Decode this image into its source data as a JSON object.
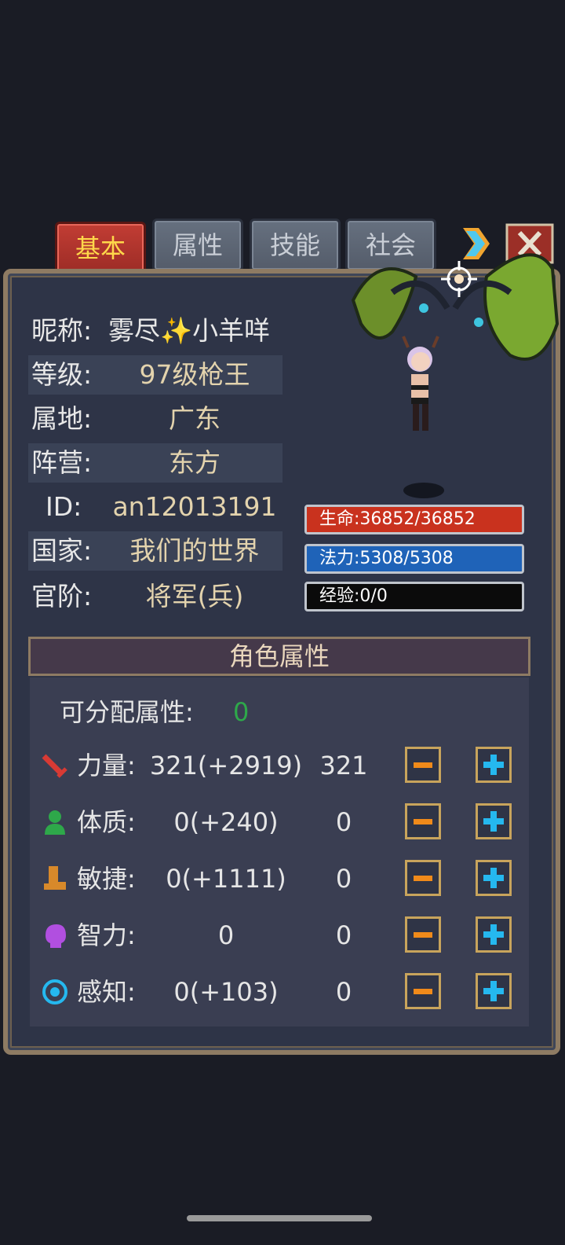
{
  "tabs": [
    {
      "label": "基本",
      "active": true
    },
    {
      "label": "属性",
      "active": false
    },
    {
      "label": "技能",
      "active": false
    },
    {
      "label": "社会",
      "active": false
    }
  ],
  "profile": {
    "nickname_label": "昵称:",
    "nickname": "雾尽✨小羊咩",
    "level_label": "等级:",
    "level": "97级枪王",
    "location_label": "属地:",
    "location": "广东",
    "faction_label": "阵营:",
    "faction": "东方",
    "id_label": "ID:",
    "id": "an12013191",
    "country_label": "国家:",
    "country": "我们的世界",
    "rank_label": "官阶:",
    "rank": "将军(兵)"
  },
  "bars": {
    "hp": {
      "text": "生命:36852/36852",
      "fraction": 1.0,
      "color": "#c9321e"
    },
    "mp": {
      "text": "法力:5308/5308",
      "fraction": 1.0,
      "color": "#1f63b8"
    },
    "exp": {
      "text": "经验:0/0",
      "fraction": 0.0,
      "color": "#000000"
    }
  },
  "attributes": {
    "section_title": "角色属性",
    "free_points_label": "可分配属性:",
    "free_points": "0",
    "rows": [
      {
        "icon": "sword-icon",
        "label": "力量:",
        "base": "321(+2919)",
        "alloc": "321"
      },
      {
        "icon": "person-icon",
        "label": "体质:",
        "base": "0(+240)",
        "alloc": "0"
      },
      {
        "icon": "boot-icon",
        "label": "敏捷:",
        "base": "0(+1111)",
        "alloc": "0"
      },
      {
        "icon": "head-icon",
        "label": "智力:",
        "base": "0",
        "alloc": "0"
      },
      {
        "icon": "eye-ring-icon",
        "label": "感知:",
        "base": "0(+103)",
        "alloc": "0"
      }
    ]
  },
  "colors": {
    "accent_gold": "#e3d3ad",
    "active_tab": "#b3342d",
    "plus": "#25b8ef",
    "minus": "#f08a1a",
    "free_points": "#2ea84a"
  }
}
